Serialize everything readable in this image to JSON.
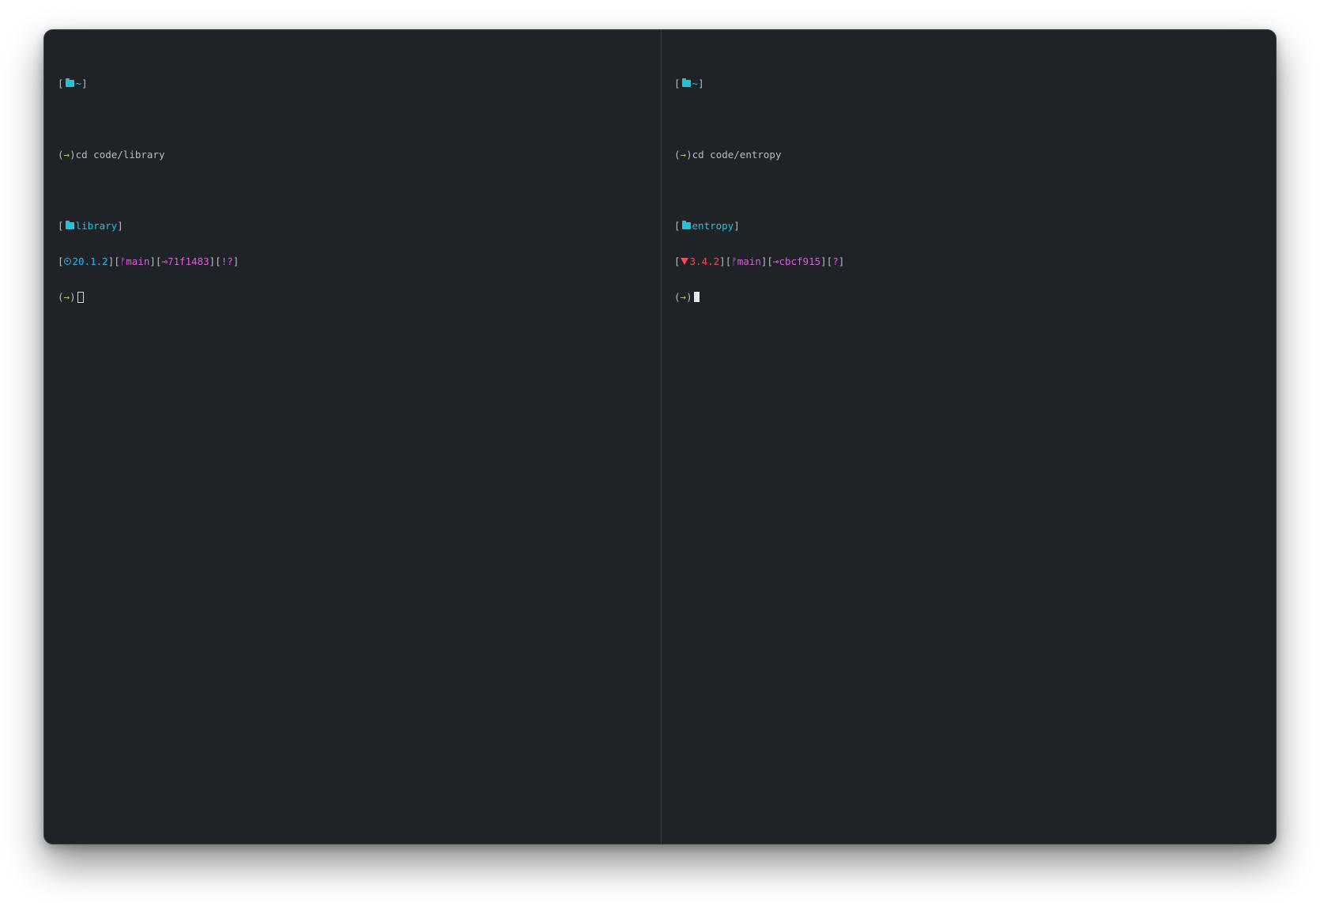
{
  "colors": {
    "background": "#1f2227",
    "text": "#b7bcc4",
    "directory": "#20c4d9",
    "prompt_arrow": "#9ad05a",
    "git": "#d75fd7",
    "node": "#3bb4e5",
    "ruby": "#f04b58"
  },
  "left_pane": {
    "home_prompt": {
      "open": "[",
      "icon": "folder-icon",
      "dir": "~",
      "close": "]"
    },
    "command_prompt": {
      "open": "(",
      "arrow": "→",
      "close": ")",
      "command": "cd code/library"
    },
    "dir_prompt": {
      "open": "[",
      "icon": "folder-icon",
      "dir": "library",
      "close": "]"
    },
    "status_line": {
      "open": "[",
      "runtime_icon": "nodejs-icon",
      "runtime_version": "20.1.2",
      "sep1": "][",
      "branch_icon": "git-branch-icon",
      "branch_glyph": "ᚠ",
      "branch": "main",
      "sep2": "][",
      "commit_icon": "git-commit-icon",
      "commit_glyph": "⊸",
      "commit": "71f1483",
      "sep3": "][",
      "git_status": "!?",
      "close": "]"
    },
    "input_prompt": {
      "open": "(",
      "arrow": "→",
      "close": ")"
    }
  },
  "right_pane": {
    "home_prompt": {
      "open": "[",
      "icon": "folder-icon",
      "dir": "~",
      "close": "]"
    },
    "command_prompt": {
      "open": "(",
      "arrow": "→",
      "close": ")",
      "command": "cd code/entropy"
    },
    "dir_prompt": {
      "open": "[",
      "icon": "folder-icon",
      "dir": "entropy",
      "close": "]"
    },
    "status_line": {
      "open": "[",
      "runtime_icon": "ruby-icon",
      "runtime_version": "3.4.2",
      "sep1": "][",
      "branch_icon": "git-branch-icon",
      "branch_glyph": "ᚠ",
      "branch": "main",
      "sep2": "][",
      "commit_icon": "git-commit-icon",
      "commit_glyph": "⊸",
      "commit": "cbcf915",
      "sep3": "][",
      "git_status": "?",
      "close": "]"
    },
    "input_prompt": {
      "open": "(",
      "arrow": "→",
      "close": ")"
    }
  }
}
